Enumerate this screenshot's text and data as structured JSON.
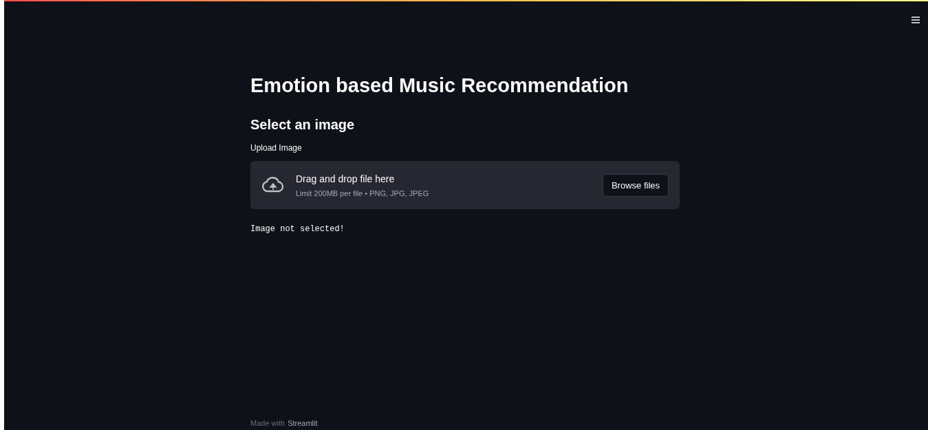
{
  "title": "Emotion based Music Recommendation",
  "subheader": "Select an image",
  "uploader": {
    "label": "Upload Image",
    "instruction": "Drag and drop file here",
    "limit": "Limit 200MB per file • PNG, JPG, JPEG",
    "button": "Browse files"
  },
  "message": "Image not selected!",
  "footer": {
    "text": "Made with",
    "link": "Streamlit"
  }
}
